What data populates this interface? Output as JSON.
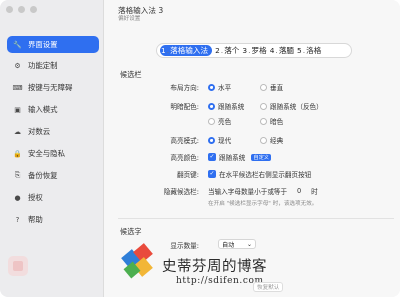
{
  "window": {
    "title": "落格输入法 3",
    "subtitle": "偏好设置"
  },
  "sidebar": {
    "items": [
      {
        "label": "界面设置",
        "icon": "wrench-icon"
      },
      {
        "label": "功能定制",
        "icon": "sliders-icon"
      },
      {
        "label": "按键与无障碍",
        "icon": "keyboard-icon"
      },
      {
        "label": "输入模式",
        "icon": "input-mode-icon"
      },
      {
        "label": "对数云",
        "icon": "cloud-icon"
      },
      {
        "label": "安全与隐私",
        "icon": "lock-icon"
      },
      {
        "label": "备份恢复",
        "icon": "backup-icon"
      },
      {
        "label": "授权",
        "icon": "key-icon"
      },
      {
        "label": "帮助",
        "icon": "help-icon"
      }
    ]
  },
  "preview": {
    "candidates": [
      {
        "num": "1",
        "text": "落格输入法"
      },
      {
        "num": "2",
        "text": "落个"
      },
      {
        "num": "3",
        "text": "罗格"
      },
      {
        "num": "4",
        "text": "落腼"
      },
      {
        "num": "5",
        "text": "洛格"
      }
    ]
  },
  "candidate_bar": {
    "section": "候选栏",
    "layout": {
      "label": "布局方向:",
      "options": [
        "水平",
        "垂直"
      ],
      "selected": "水平"
    },
    "color_scheme": {
      "label": "明暗配色:",
      "options": [
        "跟随系统",
        "跟随系统（反色）",
        "亮色",
        "暗色"
      ],
      "selected": "跟随系统"
    },
    "highlight_mode": {
      "label": "高亮模式:",
      "options": [
        "现代",
        "经典"
      ],
      "selected": "现代"
    },
    "highlight_color": {
      "label": "高亮颜色:",
      "option": "跟随系统",
      "badge": "自定义"
    },
    "paging": {
      "label": "翻页键:",
      "option": "在水平候选栏右侧显示翻页按钮"
    },
    "hide_bar": {
      "label": "隐藏候选栏:",
      "text_before": "当输入字母数量小于或等于",
      "value": "0",
      "text_after": "时",
      "hint": "在开启 \"候选栏显示字母\" 时，该选项无效。"
    }
  },
  "candidate_word": {
    "section": "候选字",
    "display_count": {
      "label": "显示数量:",
      "value": "自动"
    }
  },
  "watermark": {
    "text": "史蒂芬周的博客",
    "url": "http://sdifen.com",
    "button": "恢复默认"
  },
  "colors": {
    "accent": "#2f6ff0"
  }
}
